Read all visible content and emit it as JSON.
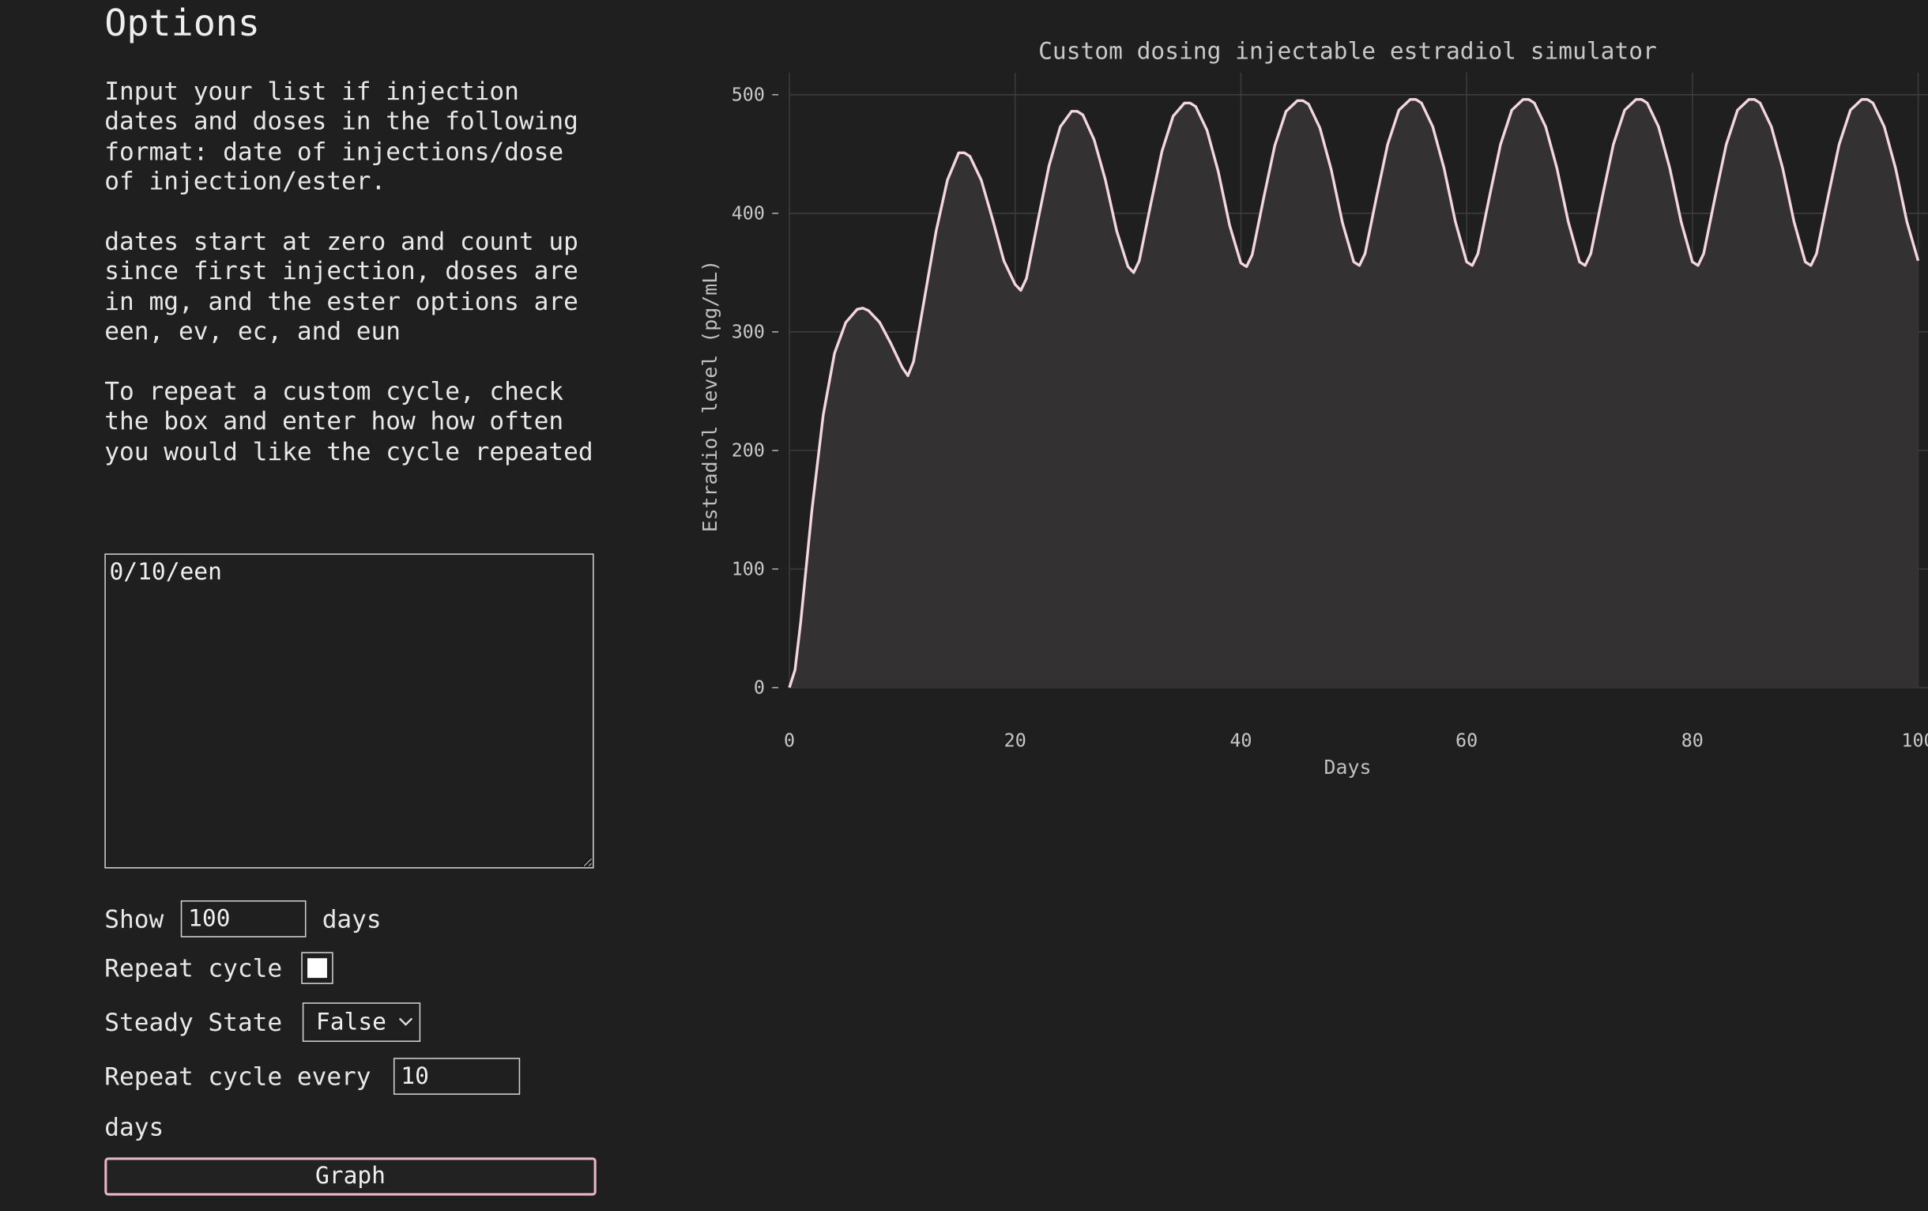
{
  "options": {
    "title": "Options",
    "paragraphs": [
      "Input your list if injection dates and doses in the following format: date of injections/dose of injection/ester.",
      "dates start at zero and count up since first injection, doses are in mg, and the ester options are een, ev, ec, and eun",
      "To repeat a custom cycle, check the box and enter how how often you would like the cycle repeated"
    ],
    "cycle_text": "0/10/een",
    "show_label": "Show",
    "show_value": "100",
    "days_label": "days",
    "repeat_label": "Repeat cycle",
    "repeat_checked": false,
    "steady_label": "Steady State",
    "steady_value": "False",
    "every_label": "Repeat cycle every",
    "every_value": "10",
    "every_days_label": "days",
    "graph_button": "Graph"
  },
  "colors": {
    "background": "#1f1f1f",
    "accent": "#e7b6c8",
    "curve": "#f4d6e2",
    "fill": "#333132",
    "grid": "#3c3c3c",
    "text": "#e8e8e8"
  },
  "chart_data": {
    "type": "area",
    "title": "Custom dosing injectable estradiol simulator",
    "xlabel": "Days",
    "ylabel": "Estradiol level (pg/mL)",
    "xlim": [
      0,
      100
    ],
    "ylim": [
      0,
      500
    ],
    "xticks": [
      0,
      20,
      40,
      60,
      80,
      100
    ],
    "yticks": [
      0,
      100,
      200,
      300,
      400,
      500
    ],
    "grid": true,
    "series": [
      {
        "x": [
          0,
          0.5,
          1,
          2,
          3,
          4,
          5,
          6,
          6.5,
          7,
          8,
          9,
          10,
          10.5,
          11,
          12,
          13,
          14,
          15,
          15.5,
          16,
          17,
          18,
          19,
          20,
          20.5,
          21,
          22,
          23,
          24,
          25,
          25.5,
          26,
          27,
          28,
          29,
          30,
          30.5,
          31,
          32,
          33,
          34,
          35,
          35.5,
          36,
          37,
          38,
          39,
          40,
          40.5,
          41,
          42,
          43,
          44,
          45,
          45.5,
          46,
          47,
          48,
          49,
          50,
          50.5,
          51,
          52,
          53,
          54,
          55,
          55.5,
          56,
          57,
          58,
          59,
          60,
          60.5,
          61,
          62,
          63,
          64,
          65,
          65.5,
          66,
          67,
          68,
          69,
          70,
          70.5,
          71,
          72,
          73,
          74,
          75,
          75.5,
          76,
          77,
          78,
          79,
          80,
          80.5,
          81,
          82,
          83,
          84,
          85,
          85.5,
          86,
          87,
          88,
          89,
          90,
          90.5,
          91,
          92,
          93,
          94,
          95,
          95.5,
          96,
          97,
          98,
          99,
          100
        ],
        "y": [
          0,
          15,
          55,
          150,
          230,
          282,
          308,
          319,
          320,
          318,
          308,
          290,
          270,
          263,
          275,
          330,
          385,
          428,
          451,
          451,
          448,
          428,
          395,
          360,
          340,
          335,
          345,
          393,
          440,
          473,
          486,
          486,
          483,
          462,
          428,
          385,
          355,
          350,
          360,
          407,
          452,
          482,
          493,
          493,
          490,
          470,
          435,
          390,
          358,
          355,
          365,
          412,
          457,
          486,
          495,
          495,
          492,
          472,
          437,
          392,
          359,
          356,
          366,
          413,
          458,
          487,
          496,
          496,
          493,
          473,
          438,
          393,
          359,
          356,
          366,
          413,
          458,
          487,
          496,
          496,
          493,
          473,
          438,
          393,
          359,
          356,
          366,
          413,
          458,
          487,
          496,
          496,
          493,
          473,
          438,
          393,
          359,
          356,
          366,
          413,
          458,
          487,
          496,
          496,
          493,
          473,
          438,
          393,
          359,
          356,
          366,
          413,
          458,
          487,
          496,
          496,
          493,
          473,
          438,
          393,
          360
        ]
      }
    ]
  }
}
